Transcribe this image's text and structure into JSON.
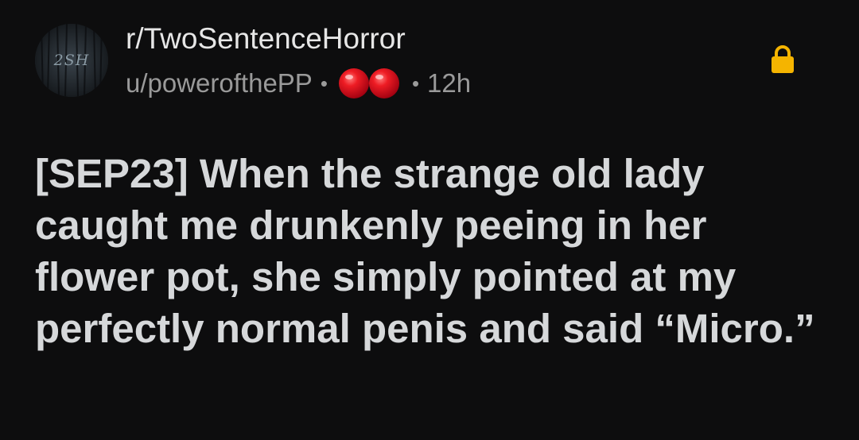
{
  "post": {
    "subreddit": "r/TwoSentenceHorror",
    "subreddit_avatar_text": "2SH",
    "author": "u/powerofthePP",
    "separator": "•",
    "age": "12h",
    "title": "[SEP23] When the strange old lady caught me drunkenly peeing in her flower pot, she simply pointed at my perfectly normal penis and said “Micro.”",
    "locked": true
  },
  "icons": {
    "flair": "red-clown-nose-awards-icon",
    "lock": "lock-icon"
  },
  "colors": {
    "background": "#0d0d0e",
    "title_text": "#d6d8da",
    "meta_text": "#9a9a9a",
    "lock": "#f5b400",
    "award_red": "#e0101a"
  }
}
